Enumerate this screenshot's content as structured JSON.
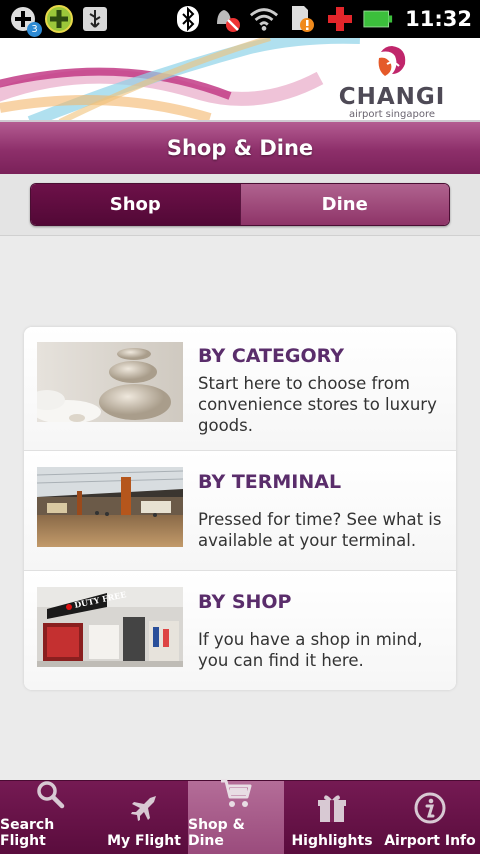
{
  "status_bar": {
    "time": "11:32",
    "notification_badge": "3",
    "left_icons": [
      "add-circle-icon",
      "add-circle-green-icon",
      "usb-icon"
    ],
    "right_icons": [
      "bluetooth-icon",
      "alarm-off-icon",
      "wifi-icon",
      "sd-card-warning-icon",
      "medical-cross-icon",
      "battery-icon"
    ]
  },
  "banner": {
    "brand_name": "CHANGI",
    "brand_sub": "airport singapore"
  },
  "header": {
    "title": "Shop & Dine"
  },
  "segment": {
    "tabs": [
      {
        "label": "Shop",
        "active": true
      },
      {
        "label": "Dine",
        "active": false
      }
    ]
  },
  "list": {
    "items": [
      {
        "title": "BY CATEGORY",
        "description": "Start here to choose from convenience stores to luxury goods."
      },
      {
        "title": "BY TERMINAL",
        "description": "Pressed for time? See what is available at your terminal."
      },
      {
        "title": "BY SHOP",
        "description": "If you have a shop in mind, you can find it here.",
        "image_sign": "DUTY FREE"
      }
    ]
  },
  "bottom_nav": {
    "items": [
      {
        "label": "Search Flight",
        "icon": "search-icon"
      },
      {
        "label": "My Flight",
        "icon": "airplane-icon"
      },
      {
        "label": "Shop & Dine",
        "icon": "shopping-cart-icon",
        "active": true
      },
      {
        "label": "Highlights",
        "icon": "gift-icon"
      },
      {
        "label": "Airport Info",
        "icon": "info-icon"
      }
    ]
  },
  "colors": {
    "accent": "#8d2f6a",
    "title_text": "#5a2d6b",
    "nav_background": "#5a0c3d"
  }
}
